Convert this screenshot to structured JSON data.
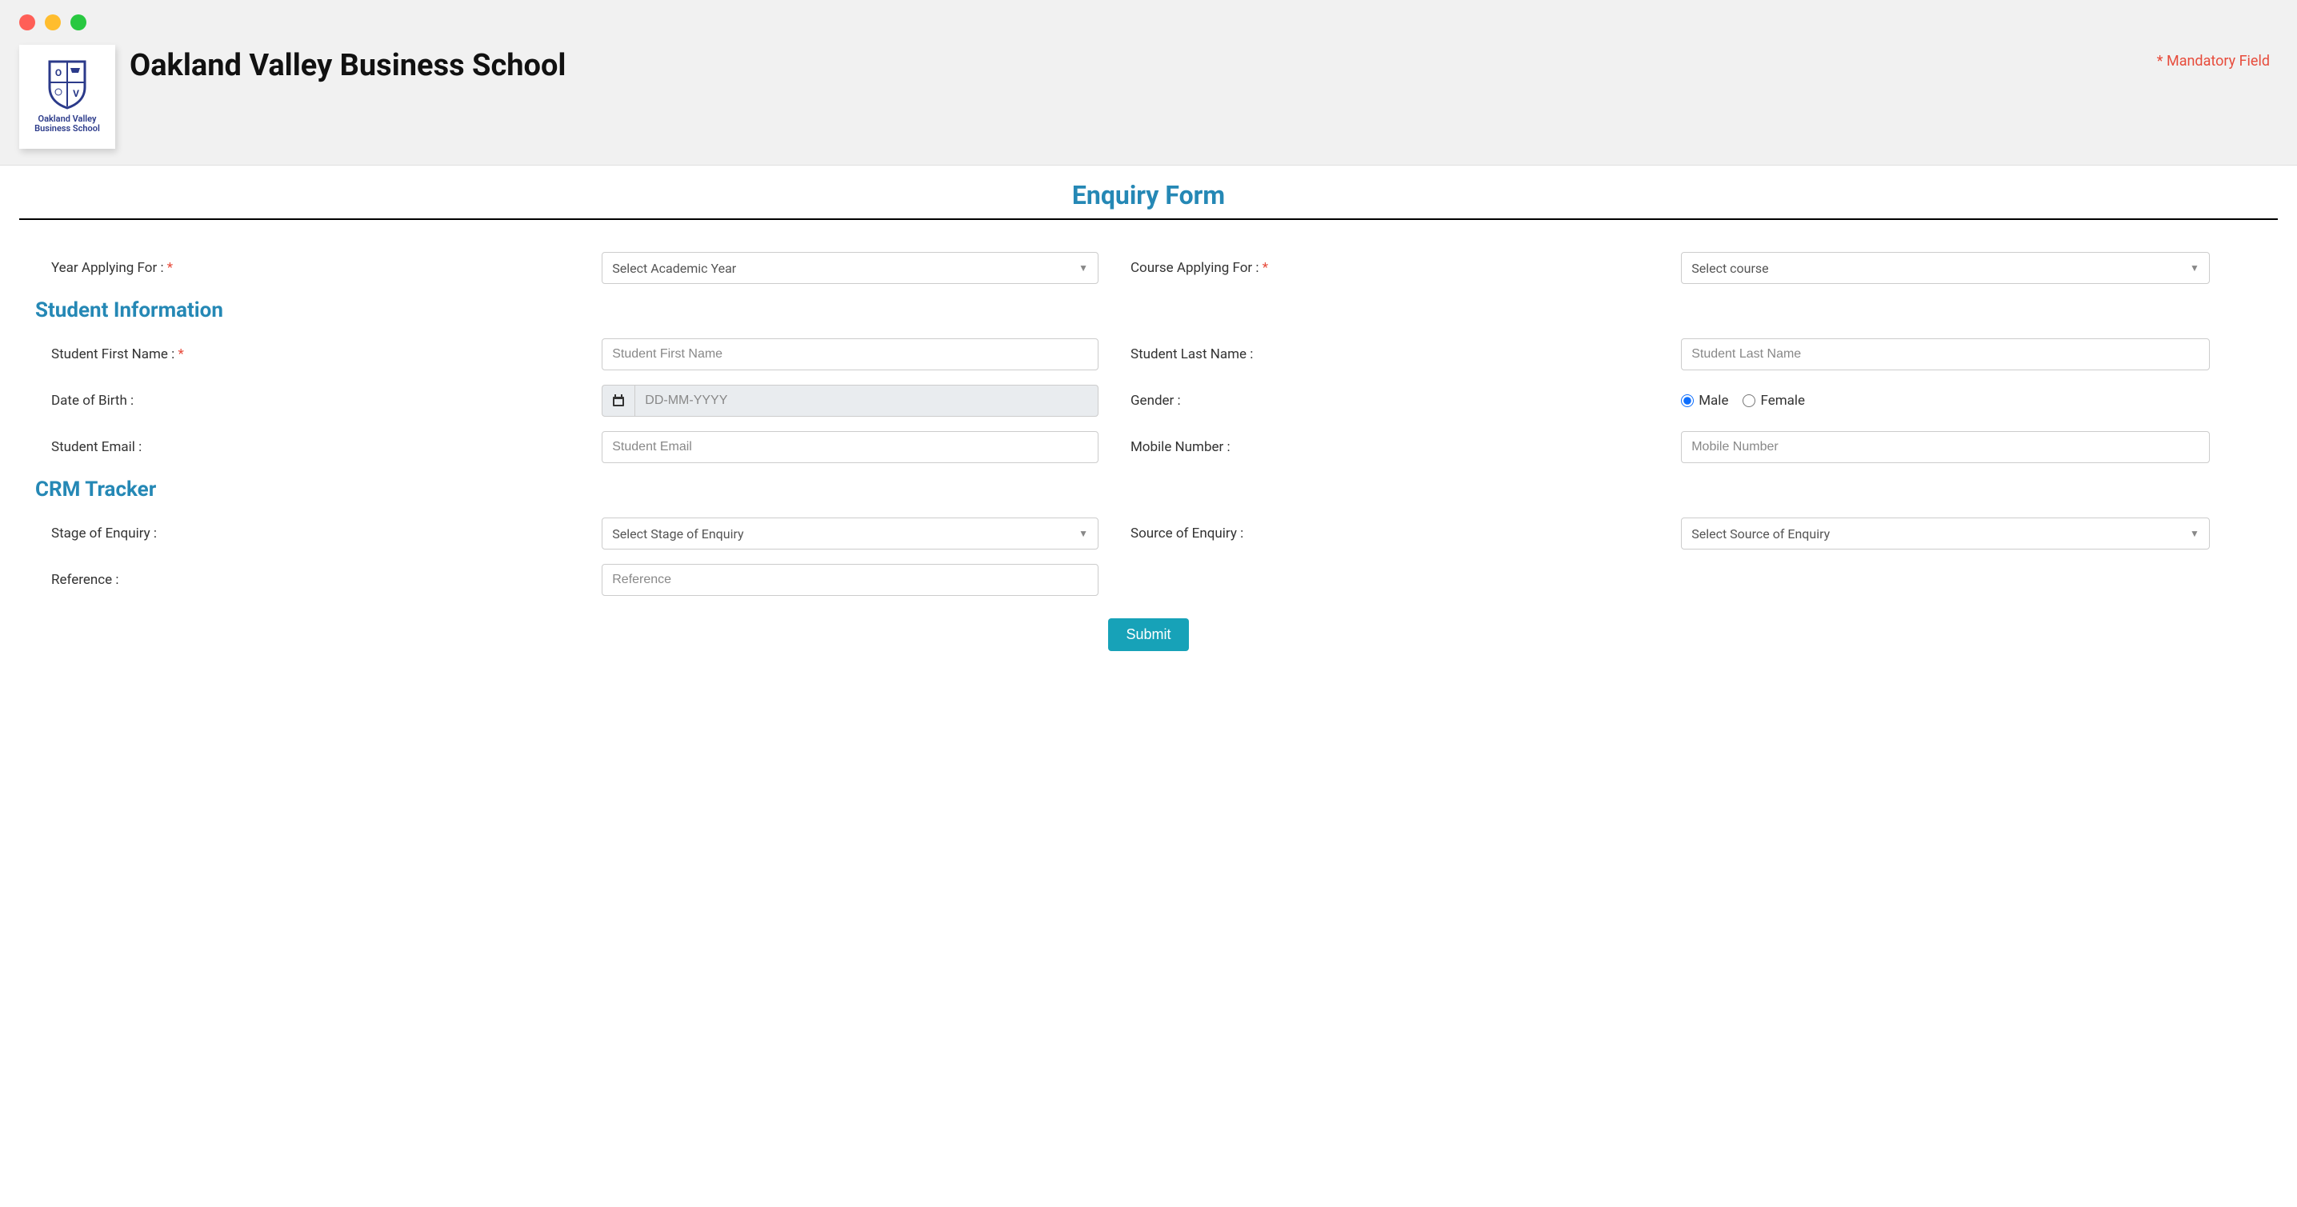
{
  "header": {
    "school_name": "Oakland Valley Business School",
    "logo_line1": "Oakland Valley",
    "logo_line2": "Business School",
    "mandatory_note": "* Mandatory Field"
  },
  "form": {
    "title": "Enquiry Form",
    "top": {
      "year_label": "Year Applying For :",
      "year_select": "Select Academic Year",
      "course_label": "Course Applying For :",
      "course_select": "Select course"
    },
    "student_section_title": "Student Information",
    "student": {
      "first_name_label": "Student First Name :",
      "first_name_placeholder": "Student First Name",
      "last_name_label": "Student Last Name :",
      "last_name_placeholder": "Student Last Name",
      "dob_label": "Date of Birth :",
      "dob_placeholder": "DD-MM-YYYY",
      "gender_label": "Gender :",
      "gender_male": "Male",
      "gender_female": "Female",
      "email_label": "Student Email :",
      "email_placeholder": "Student Email",
      "mobile_label": "Mobile Number :",
      "mobile_placeholder": "Mobile Number"
    },
    "crm_section_title": "CRM Tracker",
    "crm": {
      "stage_label": "Stage of Enquiry :",
      "stage_select": "Select Stage of Enquiry",
      "source_label": "Source of Enquiry :",
      "source_select": "Select Source of Enquiry",
      "reference_label": "Reference :",
      "reference_placeholder": "Reference"
    },
    "submit_label": "Submit"
  }
}
